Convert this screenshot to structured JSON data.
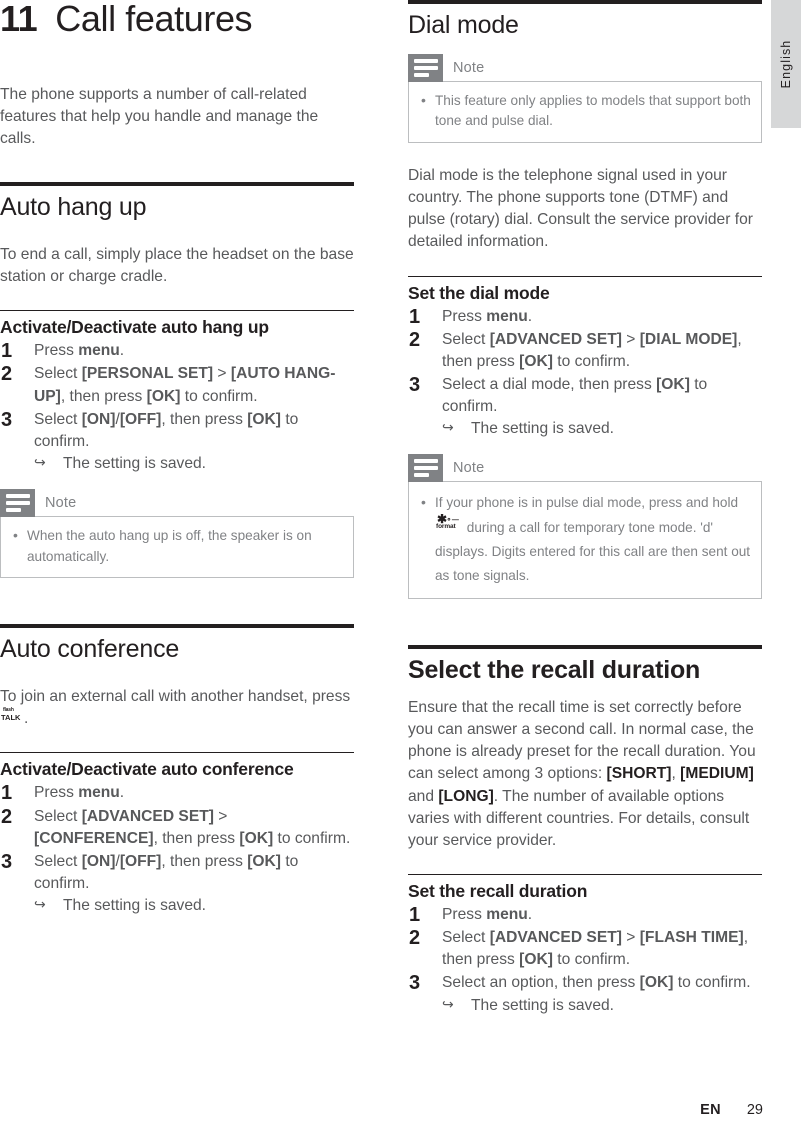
{
  "document": {
    "chapter_number": "11",
    "chapter_title": "Call features",
    "language_tab": "English",
    "footer": {
      "language_code": "EN",
      "page_number": "29"
    }
  },
  "left_column": {
    "intro": "The phone supports a number of call-related features that help you handle and manage the calls.",
    "section_auto_hang_up": {
      "title": "Auto hang up",
      "body": "To end a call, simply place the headset on the base station or charge cradle.",
      "subsection": {
        "title": "Activate/Deactivate auto hang up",
        "steps": [
          {
            "num": "1",
            "text_html": "Press <b>menu</b>."
          },
          {
            "num": "2",
            "text_html": "Select <b>[PERSONAL SET]</b> &gt; <b>[AUTO HANG-UP]</b>, then press <b>[OK]</b> to confirm."
          },
          {
            "num": "3",
            "text_html": "Select <b>[ON]</b>/<b>[OFF]</b>, then press <b>[OK]</b> to confirm.",
            "result": "The setting is saved."
          }
        ]
      },
      "note": {
        "icon_name": "note-icon",
        "title": "Note",
        "items": [
          "When the auto hang up is off, the speaker is on automatically."
        ]
      }
    },
    "section_auto_conference": {
      "title": "Auto conference",
      "body_before_key": "To join an external call with another handset, press",
      "body_key_icon": "flash-talk-key-icon",
      "body_key_top": "flash",
      "body_key_bottom": "TALK",
      "body_after_key": ".",
      "subsection": {
        "title": "Activate/Deactivate auto conference",
        "steps": [
          {
            "num": "1",
            "text_html": "Press <b>menu</b>."
          },
          {
            "num": "2",
            "text_html": "Select <b>[ADVANCED SET]</b> &gt; <b>[CONFERENCE]</b>, then press <b>[OK]</b> to confirm."
          },
          {
            "num": "3",
            "text_html": "Select <b>[ON]</b>/<b>[OFF]</b>, then press <b>[OK]</b> to confirm.",
            "result": "The setting is saved."
          }
        ]
      }
    }
  },
  "right_column": {
    "section_dial_mode": {
      "title": "Dial mode",
      "note_top": {
        "icon_name": "note-icon",
        "title": "Note",
        "items": [
          "This feature only applies to models that support both tone and pulse dial."
        ]
      },
      "body": "Dial mode is the telephone signal used in your country. The phone supports tone (DTMF) and pulse (rotary) dial. Consult the service provider for detailed information.",
      "subsection": {
        "title": "Set the dial mode",
        "steps": [
          {
            "num": "1",
            "text_html": "Press <b>menu</b>."
          },
          {
            "num": "2",
            "text_html": "Select <b>[ADVANCED SET]</b> &gt; <b>[DIAL MODE]</b>, then press <b>[OK]</b> to confirm."
          },
          {
            "num": "3",
            "text_html": "Select a dial mode, then press <b>[OK]</b> to confirm.",
            "result": "The setting is saved."
          }
        ]
      },
      "note_bottom": {
        "icon_name": "note-icon",
        "title": "Note",
        "item_before_key": "If your phone is in pulse dial mode, press and hold",
        "key_icon": "star-format-key-icon",
        "key_label": "format",
        "item_after_key": "during a call for temporary tone mode. 'd' displays. Digits entered for this call are then sent out as tone signals."
      }
    },
    "section_recall_duration": {
      "title": "Select the recall duration",
      "body_html": "Ensure that the recall time is set correctly before you can answer a second call. In normal case, the phone is already preset for the recall duration. You can select among 3 options: <b>[SHORT]</b>, <b>[MEDIUM]</b> and <b>[LONG]</b>. The number of available options varies with different countries. For details, consult your service provider.",
      "subsection": {
        "title": "Set the recall duration",
        "steps": [
          {
            "num": "1",
            "text_html": "Press <b>menu</b>."
          },
          {
            "num": "2",
            "text_html": "Select <b>[ADVANCED SET]</b> &gt; <b>[FLASH TIME]</b>, then press <b>[OK]</b> to confirm."
          },
          {
            "num": "3",
            "text_html": "Select an option, then press <b>[OK]</b> to confirm.",
            "result": "The setting is saved."
          }
        ]
      }
    }
  },
  "colors": {
    "text_dark": "#231f20",
    "text_gray": "#58595b",
    "note_gray": "#808285",
    "note_border": "#bcbec0",
    "tab_bg": "#d6d7d8"
  }
}
